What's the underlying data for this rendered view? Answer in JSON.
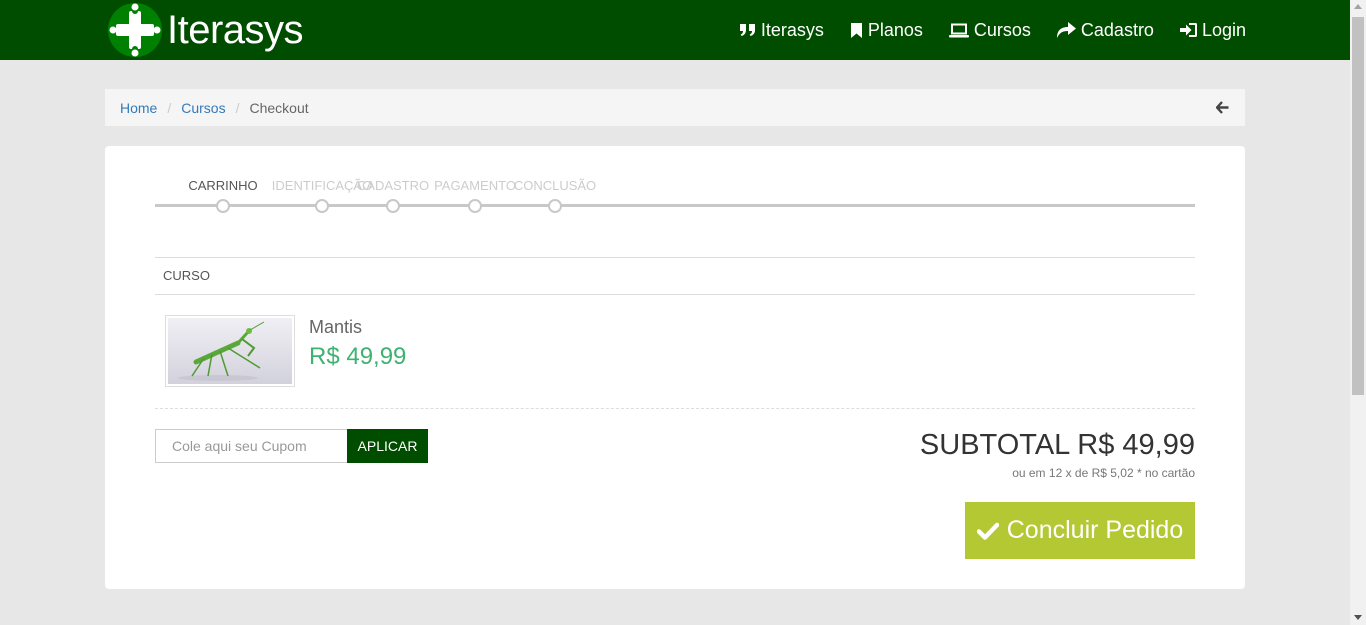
{
  "brand": {
    "name": "Iterasys"
  },
  "nav": {
    "items": [
      {
        "label": "Iterasys",
        "icon": "quote-icon"
      },
      {
        "label": "Planos",
        "icon": "bookmark-icon"
      },
      {
        "label": "Cursos",
        "icon": "laptop-icon"
      },
      {
        "label": "Cadastro",
        "icon": "share-icon"
      },
      {
        "label": "Login",
        "icon": "sign-in-icon"
      }
    ]
  },
  "breadcrumb": {
    "home": "Home",
    "courses": "Cursos",
    "current": "Checkout",
    "separator": "/"
  },
  "steps": [
    {
      "label": "CARRINHO",
      "active": true
    },
    {
      "label": "IDENTIFICAÇÃO",
      "active": false
    },
    {
      "label": "CADASTRO",
      "active": false
    },
    {
      "label": "PAGAMENTO",
      "active": false
    },
    {
      "label": "CONCLUSÃO",
      "active": false
    }
  ],
  "table": {
    "header": "CURSO"
  },
  "product": {
    "name": "Mantis",
    "price": "R$ 49,99"
  },
  "coupon": {
    "placeholder": "Cole aqui seu Cupom",
    "value": "",
    "button_label": "APLICAR"
  },
  "summary": {
    "subtotal": "SUBTOTAL R$ 49,99",
    "installments": "ou em 12 x de R$ 5,02 * no cartão"
  },
  "checkout": {
    "button_label": "Concluir Pedido"
  },
  "colors": {
    "navbar": "#004d00",
    "price": "#3cb371",
    "checkout_button": "#b3c833",
    "link": "#337ab7"
  }
}
